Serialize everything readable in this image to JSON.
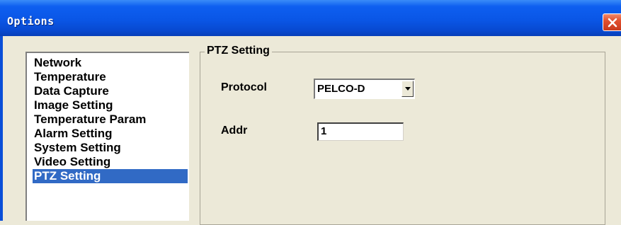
{
  "window": {
    "title": "Options",
    "close_icon": "close-icon"
  },
  "sidebar": {
    "items": [
      {
        "label": "Network",
        "selected": false
      },
      {
        "label": "Temperature",
        "selected": false
      },
      {
        "label": "Data Capture",
        "selected": false
      },
      {
        "label": "Image Setting",
        "selected": false
      },
      {
        "label": "Temperature Param",
        "selected": false
      },
      {
        "label": "Alarm Setting",
        "selected": false
      },
      {
        "label": "System Setting",
        "selected": false
      },
      {
        "label": "Video Setting",
        "selected": false
      },
      {
        "label": "PTZ Setting",
        "selected": true
      }
    ]
  },
  "ptz": {
    "group_title": "PTZ Setting",
    "protocol_label": "Protocol",
    "protocol_value": "PELCO-D",
    "addr_label": "Addr",
    "addr_value": "1"
  },
  "colors": {
    "titlebar": "#0a56e6",
    "selection": "#316ac5",
    "dialog_background": "#ece9d8",
    "close_button": "#e2502e"
  }
}
